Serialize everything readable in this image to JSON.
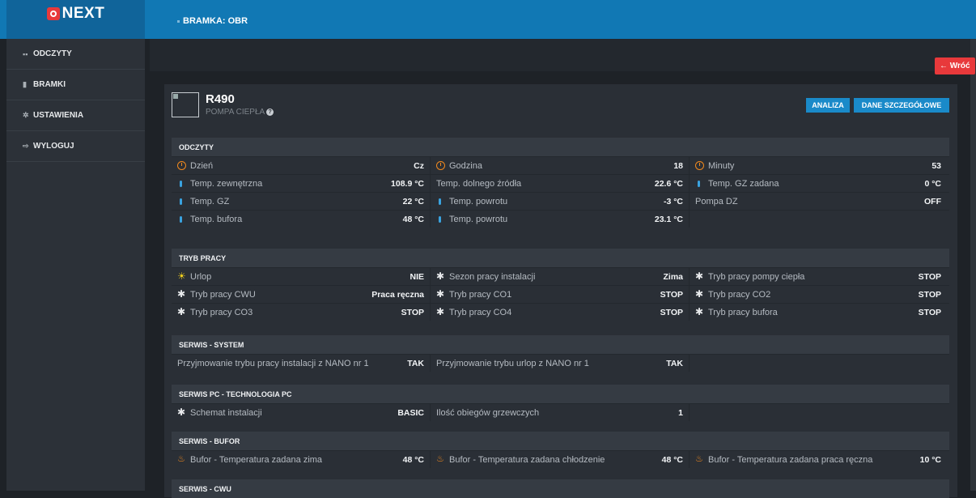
{
  "app": {
    "logo": "NEXT",
    "breadcrumb": "BRAMKA: OBR"
  },
  "sidebar": {
    "items": [
      {
        "label": "ODCZYTY",
        "icon": "grid-icon"
      },
      {
        "label": "BRAMKI",
        "icon": "book-icon"
      },
      {
        "label": "USTAWIENIA",
        "icon": "gear-icon"
      },
      {
        "label": "WYLOGUJ",
        "icon": "logout-icon"
      }
    ]
  },
  "buttons": {
    "back": "← Wróć",
    "analysis": "ANALIZA",
    "details": "DANE SZCZEGÓŁOWE"
  },
  "device": {
    "name": "R490",
    "type": "POMPA CIEPŁA",
    "help": "?"
  },
  "sections": [
    {
      "title": "ODCZYTY",
      "rows": [
        [
          {
            "icon": "clock",
            "label": "Dzień",
            "value": "Cz"
          },
          {
            "icon": "clock",
            "label": "Godzina",
            "value": "18"
          },
          {
            "icon": "clock",
            "label": "Minuty",
            "value": "53"
          }
        ],
        [
          {
            "icon": "therm",
            "label": "Temp. zewnętrzna",
            "value": "108.9 °C"
          },
          {
            "icon": "none",
            "label": "Temp. dolnego źródła",
            "value": "22.6 °C"
          },
          {
            "icon": "therm",
            "label": "Temp. GZ zadana",
            "value": "0 °C"
          }
        ],
        [
          {
            "icon": "therm",
            "label": "Temp. GZ",
            "value": "22 °C"
          },
          {
            "icon": "therm",
            "label": "Temp. powrotu",
            "value": "-3 °C"
          },
          {
            "icon": "none",
            "label": "Pompa DZ",
            "value": "OFF"
          }
        ],
        [
          {
            "icon": "therm",
            "label": "Temp. bufora",
            "value": "48 °C"
          },
          {
            "icon": "therm",
            "label": "Temp. powrotu",
            "value": "23.1 °C"
          },
          {
            "icon": "empty",
            "label": "",
            "value": ""
          }
        ]
      ]
    },
    {
      "title": "TRYB PRACY",
      "rows": [
        [
          {
            "icon": "sun",
            "label": "Urlop",
            "value": "NIE"
          },
          {
            "icon": "gear",
            "label": "Sezon pracy instalacji",
            "value": "Zima"
          },
          {
            "icon": "gear",
            "label": "Tryb pracy pompy ciepła",
            "value": "STOP"
          }
        ],
        [
          {
            "icon": "gear",
            "label": "Tryb pracy CWU",
            "value": "Praca ręczna"
          },
          {
            "icon": "gear",
            "label": "Tryb pracy CO1",
            "value": "STOP"
          },
          {
            "icon": "gear",
            "label": "Tryb pracy CO2",
            "value": "STOP"
          }
        ],
        [
          {
            "icon": "gear",
            "label": "Tryb pracy CO3",
            "value": "STOP"
          },
          {
            "icon": "gear",
            "label": "Tryb pracy CO4",
            "value": "STOP"
          },
          {
            "icon": "gear",
            "label": "Tryb pracy bufora",
            "value": "STOP"
          }
        ]
      ]
    },
    {
      "title": "SERWIS - SYSTEM",
      "rows": [
        [
          {
            "icon": "none",
            "label": "Przyjmowanie trybu pracy instalacji z NANO nr 1",
            "value": "TAK"
          },
          {
            "icon": "none",
            "label": "Przyjmowanie trybu urlop z NANO nr 1",
            "value": "TAK"
          },
          {
            "icon": "empty",
            "label": "",
            "value": ""
          }
        ]
      ]
    },
    {
      "title": "SERWIS PC - TECHNOLOGIA PC",
      "rows": [
        [
          {
            "icon": "gear",
            "label": "Schemat instalacji",
            "value": "BASIC"
          },
          {
            "icon": "none",
            "label": "Ilość obiegów grzewczych",
            "value": "1"
          },
          {
            "icon": "empty",
            "label": "",
            "value": ""
          }
        ]
      ]
    },
    {
      "title": "SERWIS - BUFOR",
      "rows": [
        [
          {
            "icon": "heat",
            "label": "Bufor - Temperatura zadana zima",
            "value": "48 °C"
          },
          {
            "icon": "heat",
            "label": "Bufor - Temperatura zadana chłodzenie",
            "value": "48 °C"
          },
          {
            "icon": "heat",
            "label": "Bufor - Temperatura zadana praca ręczna",
            "value": "10 °C"
          }
        ]
      ]
    },
    {
      "title": "SERWIS - CWU",
      "rows": []
    }
  ]
}
